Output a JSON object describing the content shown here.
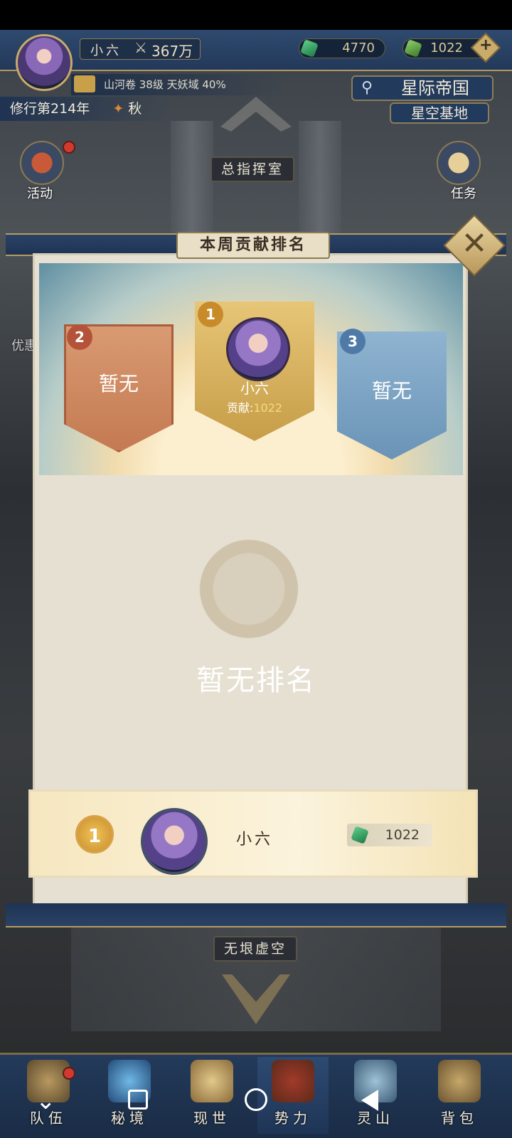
{
  "top": {
    "player_name": "小六",
    "power": "367万",
    "currency_1": "4770",
    "currency_2": "1022",
    "info": "山河卷 38级 天妖域 40%",
    "year": "修行第214年",
    "season": "秋",
    "location_main": "星际帝国",
    "location_sub": "星空基地"
  },
  "side": {
    "left": [
      "活动",
      "优惠"
    ],
    "right": [
      "任务"
    ]
  },
  "floors": {
    "upper": "总指挥室",
    "lower": "无垠虚空"
  },
  "dialog": {
    "title": "本周贡献排名",
    "podium": {
      "first": {
        "rank": "1",
        "name": "小六",
        "contrib_label": "贡献:",
        "contrib_value": "1022"
      },
      "second": {
        "rank": "2",
        "text": "暂无"
      },
      "third": {
        "rank": "3",
        "text": "暂无"
      }
    },
    "empty_text": "暂无排名",
    "my_row": {
      "rank": "1",
      "name": "小六",
      "value": "1022"
    }
  },
  "nav": {
    "items": [
      "队伍",
      "秘境",
      "现世",
      "势力",
      "灵山",
      "背包"
    ]
  }
}
